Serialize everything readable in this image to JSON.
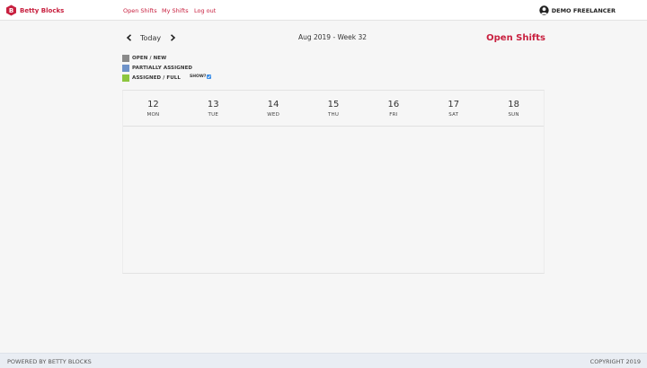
{
  "header": {
    "logo_text": "Betty Blocks",
    "logo_letter": "B",
    "nav": [
      {
        "label": "Open Shifts"
      },
      {
        "label": "My Shifts"
      },
      {
        "label": "Log out"
      }
    ],
    "user_name": "DEMO FREELANCER",
    "brand_color": "#c8203f"
  },
  "toolbar": {
    "today_label": "Today",
    "week_title": "Aug 2019 - Week 32",
    "page_heading": "Open Shifts"
  },
  "legend": {
    "items": [
      {
        "label": "OPEN / NEW",
        "color": "#8a8a8a"
      },
      {
        "label": "PARTIALLY ASSIGNED",
        "color": "#6f93c9"
      },
      {
        "label": "ASSIGNED / FULL",
        "color": "#8dc63f"
      }
    ],
    "show_label": "SHOW?",
    "show_checked": true
  },
  "calendar": {
    "days": [
      {
        "num": "12",
        "name": "MON"
      },
      {
        "num": "13",
        "name": "TUE"
      },
      {
        "num": "14",
        "name": "WED"
      },
      {
        "num": "15",
        "name": "THU"
      },
      {
        "num": "16",
        "name": "FRI"
      },
      {
        "num": "17",
        "name": "SAT"
      },
      {
        "num": "18",
        "name": "SUN"
      }
    ]
  },
  "footer": {
    "left": "POWERED BY BETTY BLOCKS",
    "right": "COPYRIGHT 2019"
  }
}
